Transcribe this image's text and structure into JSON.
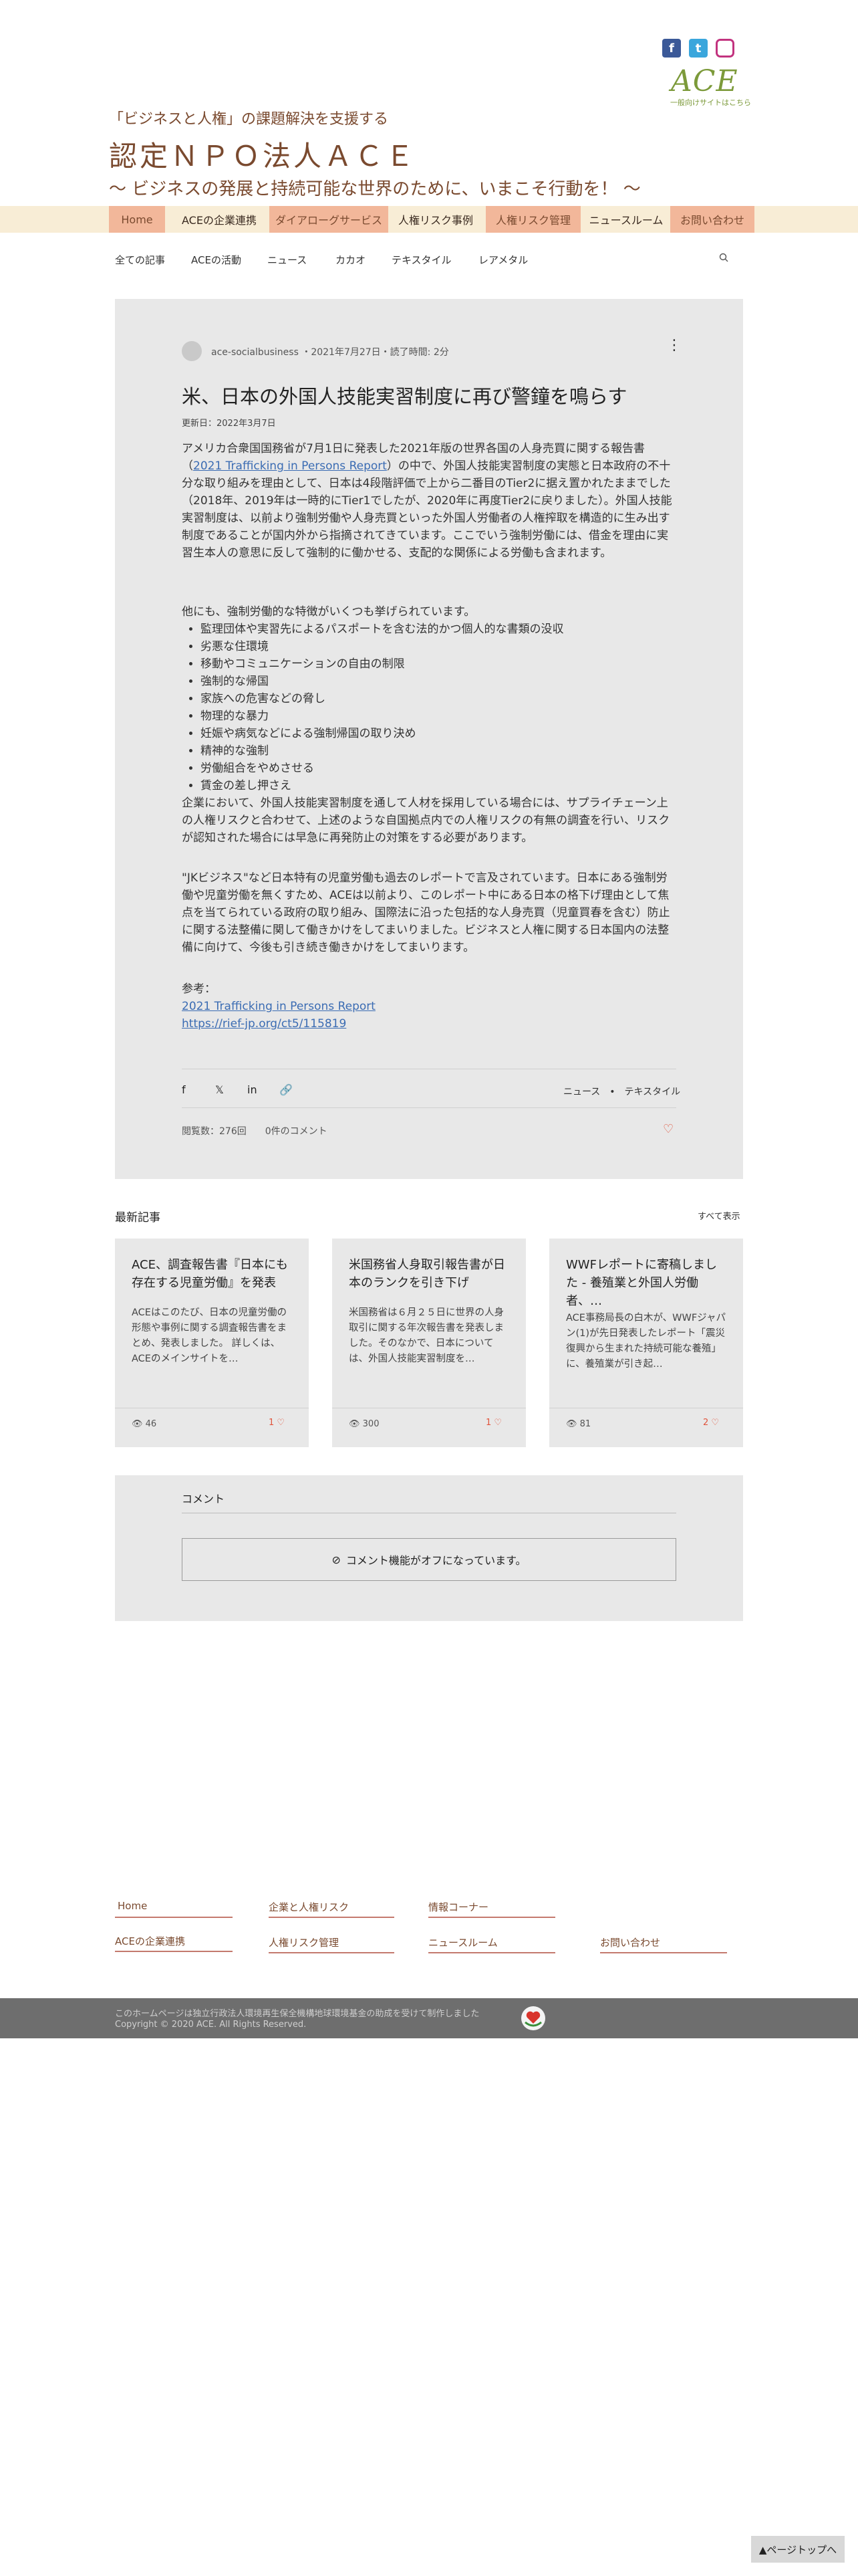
{
  "header": {
    "social": [
      "f",
      "t",
      "ig"
    ],
    "logo_text": "ACE",
    "logo_sub": "一般向けサイトはこちら",
    "tagline1": "「ビジネスと人権」の課題解決を支援する",
    "org_name": "認定ＮＰＯ法人ＡＣＥ",
    "tagline2": "〜 ビジネスの発展と持続可能な世界のために、いまこそ行動を！ 〜"
  },
  "nav": [
    "Home",
    "ACEの企業連携",
    "ダイアローグサービス",
    "人権リスク事例",
    "人権リスク管理",
    "ニュースルーム",
    "お問い合わせ"
  ],
  "categories": [
    "全ての記事",
    "ACEの活動",
    "ニュース",
    "カカオ",
    "テキスタイル",
    "レアメタル"
  ],
  "post": {
    "author": "ace-socialbusiness",
    "meta": "・2021年7月27日・読了時間: 2分",
    "title": "米、日本の外国人技能実習制度に再び警鐘を鳴らす",
    "updated": "更新日：2022年3月7日",
    "p1_a": "アメリカ合衆国国務省が7月1日に発表した2021年版の世界各国の人身売買に関する報告書（",
    "p1_link": "2021 Trafficking in Persons Report",
    "p1_b": "）の中で、外国人技能実習制度の実態と日本政府の不十分な取り組みを理由として、日本は4段階評価で上から二番目のTier2に据え置かれたままでした（2018年、2019年は一時的にTier1でしたが、2020年に再度Tier2に戻りました）。外国人技能実習制度は、以前より強制労働や人身売買といった外国人労働者の人権搾取を構造的に生み出す制度であることが国内外から指摘されてきています。ここでいう強制労働には、借金を理由に実習生本人の意思に反して強制的に働かせる、支配的な関係による労働も含まれます。",
    "p2": "他にも、強制労働的な特徴がいくつも挙げられています。",
    "bullets": [
      "監理団体や実習先によるパスポートを含む法的かつ個人的な書類の没収",
      "劣悪な住環境",
      "移動やコミュニケーションの自由の制限",
      "強制的な帰国",
      "家族への危害などの脅し",
      "物理的な暴力",
      "妊娠や病気などによる強制帰国の取り決め",
      "精神的な強制",
      "労働組合をやめさせる",
      "賃金の差し押さえ"
    ],
    "p3": "企業において、外国人技能実習制度を通して人材を採用している場合には、サプライチェーン上の人権リスクと合わせて、上述のような自国拠点内での人権リスクの有無の調査を行い、リスクが認知された場合には早急に再発防止の対策をする必要があります。",
    "p4": "\"JKビジネス\"など日本特有の児童労働も過去のレポートで言及されています。日本にある強制労働や児童労働を無くすため、ACEは以前より、このレポート中にある日本の格下げ理由として焦点を当てられている政府の取り組み、国際法に沿った包括的な人身売買（児童買春を含む）防止に関する法整備に関して働きかけをしてまいりました。ビジネスと人権に関する日本国内の法整備に向けて、今後も引き続き働きかけをしてまいります。",
    "ref_label": "参考：",
    "ref1": "2021 Trafficking in Persons Report",
    "ref2": "https://rief-jp.org/ct5/115819",
    "tags": "ニュース　•　テキスタイル",
    "stats": "閲覧数：276回　　0件のコメント"
  },
  "recent": {
    "heading": "最新記事",
    "see_all": "すべて表示",
    "items": [
      {
        "title": "ACE、調査報告書『日本にも存在する児童労働』を発表",
        "excerpt": "ACEはこのたび、日本の児童労働の形態や事例に関する調査報告書をまとめ、発表しました。 詳しくは、ACEのメインサイトを…",
        "views": "46",
        "likes": "1"
      },
      {
        "title": "米国務省人身取引報告書が日本のランクを引き下げ",
        "excerpt": "米国務省は６月２５日に世界の人身取引に関する年次報告書を発表しました。そのなかで、日本については、外国人技能実習制度を…",
        "views": "300",
        "likes": "1"
      },
      {
        "title": "WWFレポートに寄稿しました - 養殖業と外国人労働者、…",
        "excerpt": "ACE事務局長の白木が、WWFジャパン(1)が先日発表したレポート「震災復興から生まれた持続可能な養殖」に、養殖業が引き起…",
        "views": "81",
        "likes": "2"
      }
    ]
  },
  "comments": {
    "title": "コメント",
    "off_text": "コメント機能がオフになっています。"
  },
  "footer": {
    "links_row1": [
      "Home",
      "企業と人権リスク",
      "情報コーナー"
    ],
    "links_row2": [
      "ACEの企業連携",
      "人権リスク管理",
      "ニュースルーム",
      "お問い合わせ"
    ],
    "note": "このホームページは独立行政法人環境再生保全機構地球環境基金の助成を受けて制作しました",
    "copyright": "Copyright © 2020 ACE. All Rights Reserved.",
    "back_to_top": "▲ページトップへ"
  },
  "colors": {
    "brand_brown": "#7a4a2f",
    "logo_green": "#7c9a3a",
    "nav_bg": "#f8edd6",
    "nav_highlight": "#f2b79a",
    "card_bg": "#e8e8e8",
    "heart_red": "#e0533b"
  }
}
